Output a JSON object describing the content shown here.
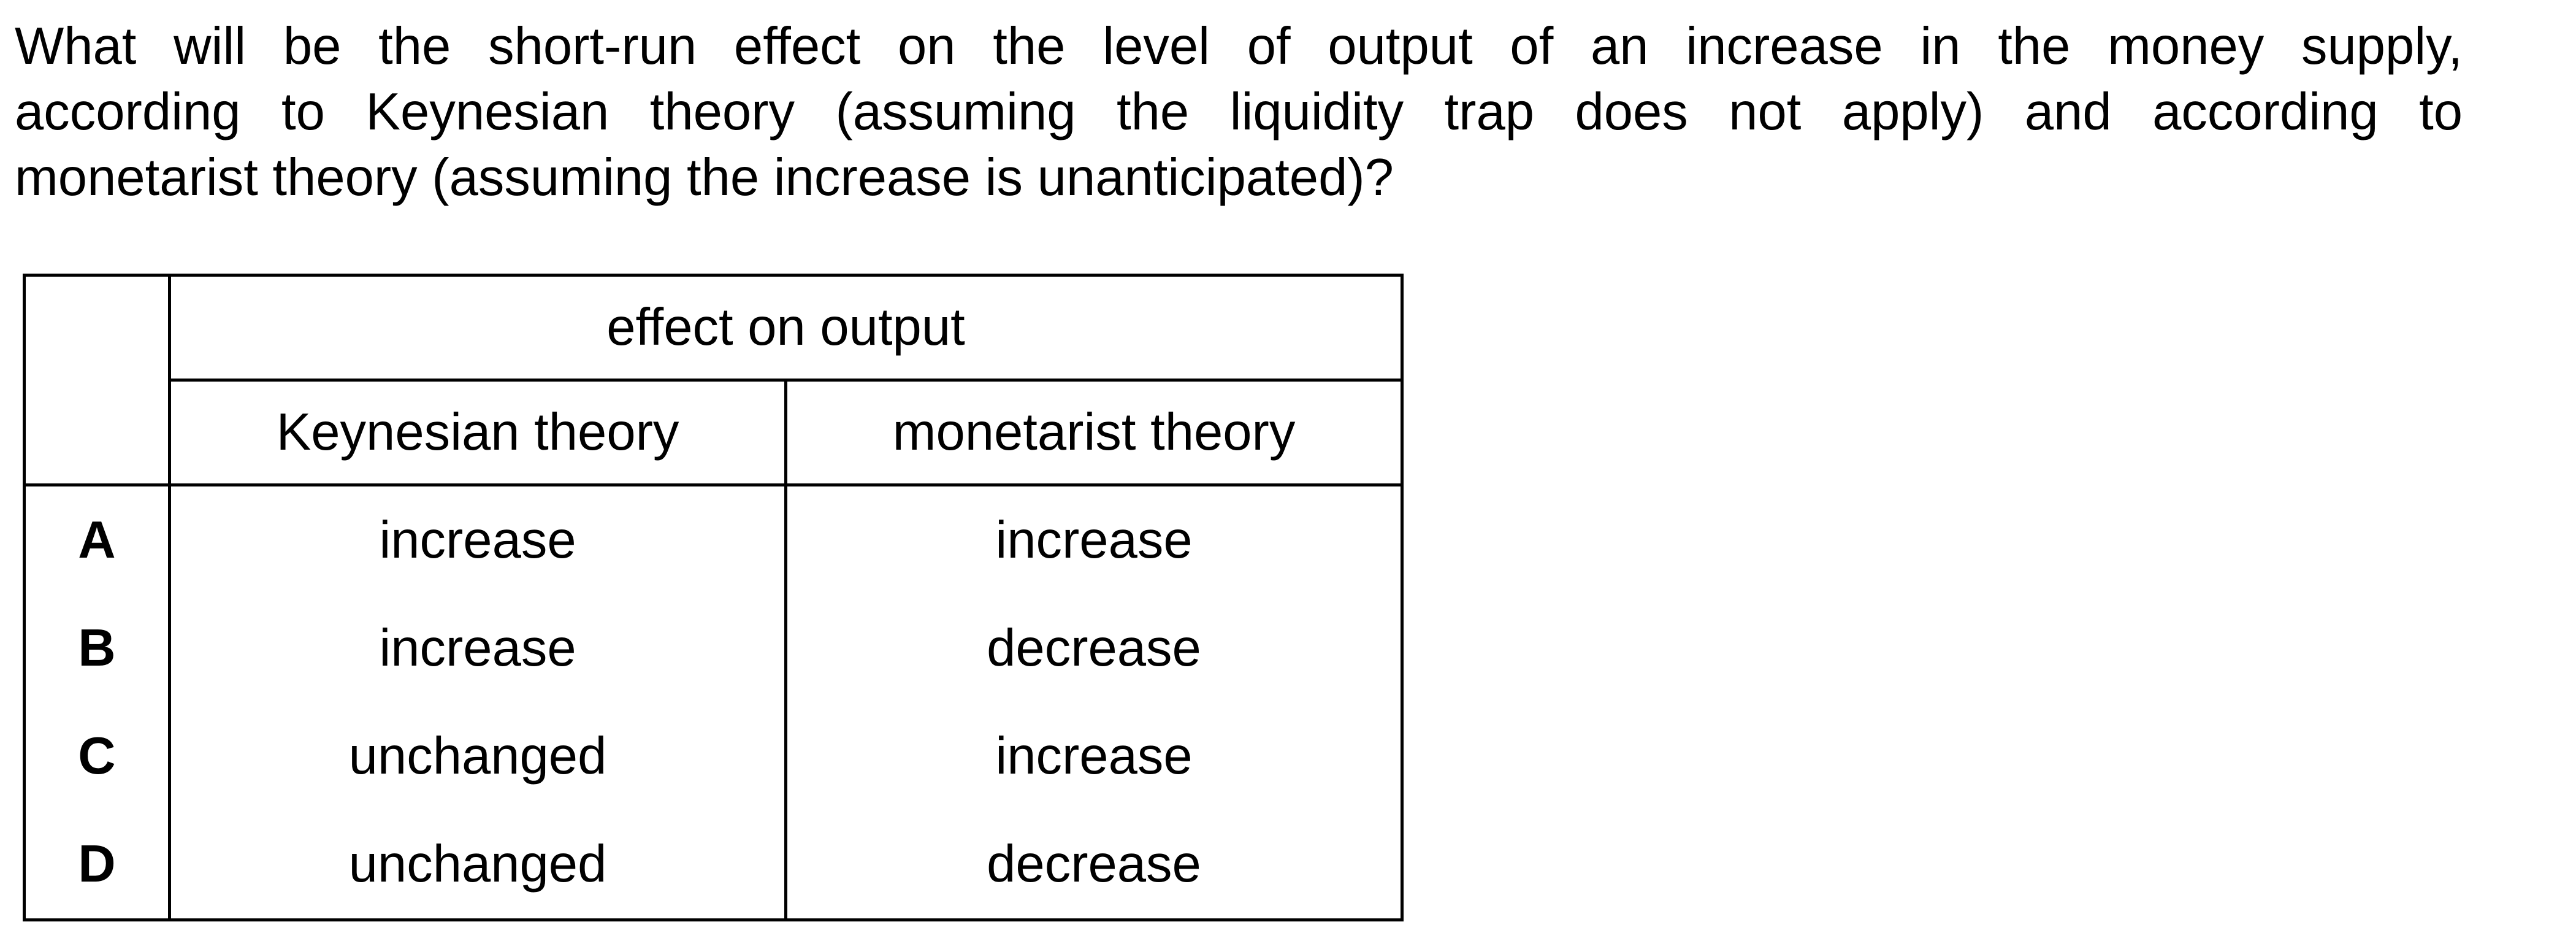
{
  "question": {
    "lines": [
      "What will be the short-run effect on the level of output of an increase in the money supply,",
      "according to Keynesian theory (assuming the liquidity trap does not apply) and according to",
      "monetarist theory (assuming the increase is unanticipated)?"
    ]
  },
  "table": {
    "group_header": "effect on output",
    "columns": [
      "Keynesian theory",
      "monetarist theory"
    ],
    "rows": [
      {
        "letter": "A",
        "keynesian": "increase",
        "monetarist": "increase"
      },
      {
        "letter": "B",
        "keynesian": "increase",
        "monetarist": "decrease"
      },
      {
        "letter": "C",
        "keynesian": "unchanged",
        "monetarist": "increase"
      },
      {
        "letter": "D",
        "keynesian": "unchanged",
        "monetarist": "decrease"
      }
    ]
  }
}
